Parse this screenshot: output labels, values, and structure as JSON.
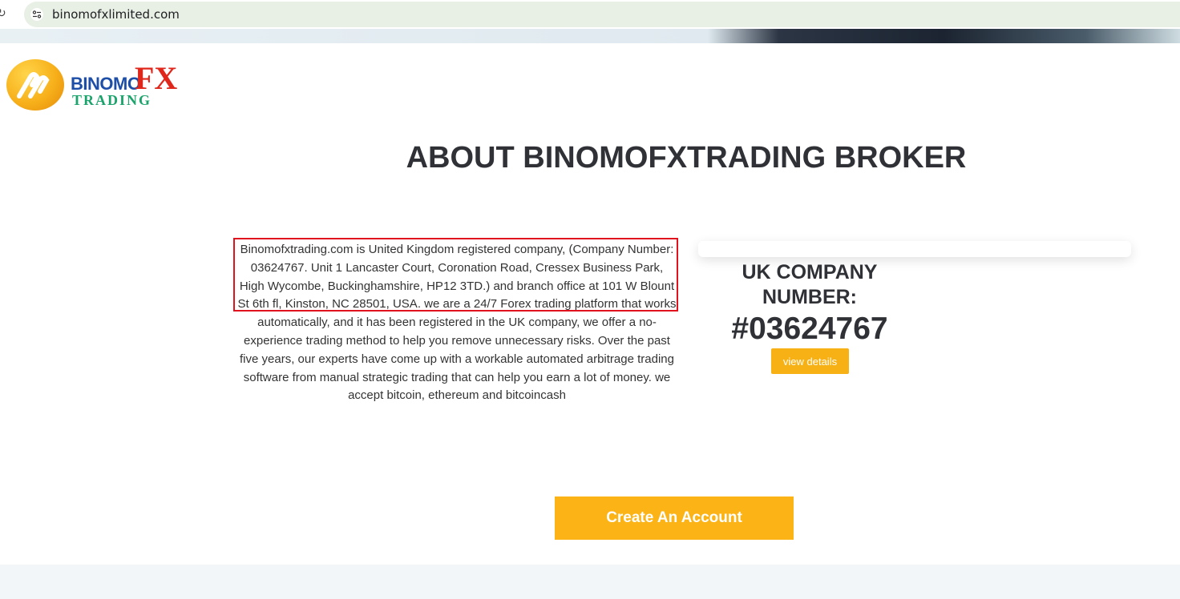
{
  "browser": {
    "url": "binomofxlimited.com",
    "reload_glyph": "↻"
  },
  "logo": {
    "binomo": "BINOMO",
    "fx": "FX",
    "trading": "TRADING"
  },
  "page_title": "ABOUT BINOMOFXTRADING BROKER",
  "about": {
    "text": "Binomofxtrading.com is United Kingdom registered company, (Company Number: 03624767. Unit 1 Lancaster Court, Coronation Road, Cressex Business Park, High Wycombe, Buckinghamshire, HP12 3TD.) and branch office at 101 W Blount St 6th fl, Kinston, NC 28501, USA. we are a 24/7 Forex trading platform that works automatically, and it has been registered in the UK company, we offer a no-experience trading method to help you remove unnecessary risks. Over the past five years, our experts have come up with a workable automated arbitrage trading software from manual strategic trading that can help you earn a lot of money. we accept bitcoin, ethereum and bitcoincash"
  },
  "company_card": {
    "heading": "UK COMPANY NUMBER:",
    "number": "#03624767",
    "view_details_label": "view details"
  },
  "cta": {
    "label": "Create An Account"
  },
  "colors": {
    "accent": "#fbb316",
    "highlight_border": "#e0121d",
    "heading": "#2f3136"
  }
}
